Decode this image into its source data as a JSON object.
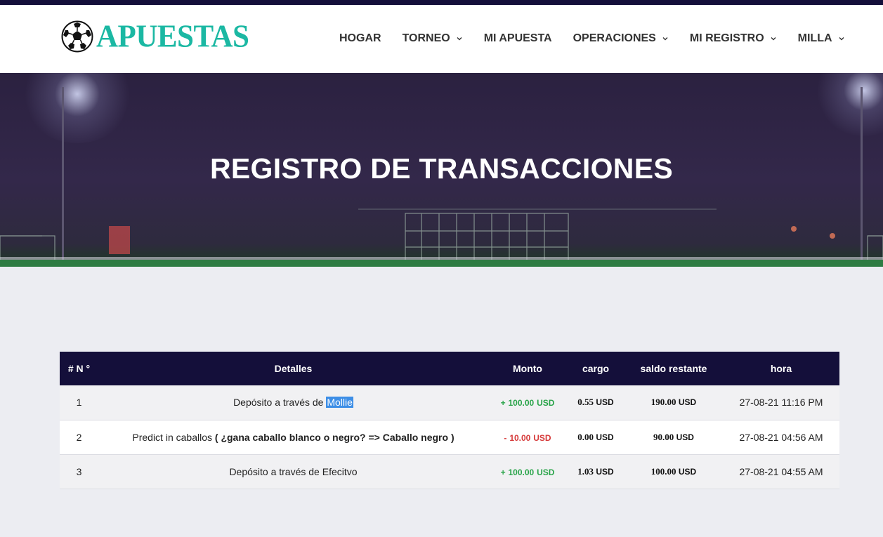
{
  "brand": {
    "name": "APUESTAS",
    "logo_icon": "soccer-ball-icon",
    "color": "#1bb8a3"
  },
  "nav": {
    "items": [
      {
        "label": "HOGAR",
        "dropdown": false
      },
      {
        "label": "TORNEO",
        "dropdown": true
      },
      {
        "label": "MI APUESTA",
        "dropdown": false
      },
      {
        "label": "OPERACIONES",
        "dropdown": true
      },
      {
        "label": "MI REGISTRO",
        "dropdown": true
      },
      {
        "label": "MILLA",
        "dropdown": true
      }
    ]
  },
  "hero": {
    "title": "REGISTRO DE TRANSACCIONES"
  },
  "colors": {
    "dark": "#140f3a",
    "positive": "#2aa44a",
    "negative": "#d63a3a",
    "page_bg": "#ecedf2"
  },
  "table": {
    "headers": [
      "# N °",
      "Detalles",
      "Monto",
      "cargo",
      "saldo restante",
      "hora"
    ],
    "rows": [
      {
        "num": "1",
        "detail_prefix": "Depósito a través de ",
        "detail_highlight": "Mollie",
        "amount_sign": "+",
        "amount_value": "100.00",
        "amount_unit": "USD",
        "charge_value": "0.55",
        "charge_unit": "USD",
        "balance_value": "190.00",
        "balance_unit": "USD",
        "time": "27-08-21 11:16 PM"
      },
      {
        "num": "2",
        "detail_prefix": "Predict in caballos ",
        "detail_bold": "( ¿gana caballo blanco o negro? => Caballo negro )",
        "amount_sign": "-",
        "amount_value": "10.00",
        "amount_unit": "USD",
        "charge_value": "0.00",
        "charge_unit": "USD",
        "balance_value": "90.00",
        "balance_unit": "USD",
        "time": "27-08-21 04:56 AM"
      },
      {
        "num": "3",
        "detail_prefix": "Depósito a través de Efecitvo",
        "amount_sign": "+",
        "amount_value": "100.00",
        "amount_unit": "USD",
        "charge_value": "1.03",
        "charge_unit": "USD",
        "balance_value": "100.00",
        "balance_unit": "USD",
        "time": "27-08-21 04:55 AM"
      }
    ]
  }
}
